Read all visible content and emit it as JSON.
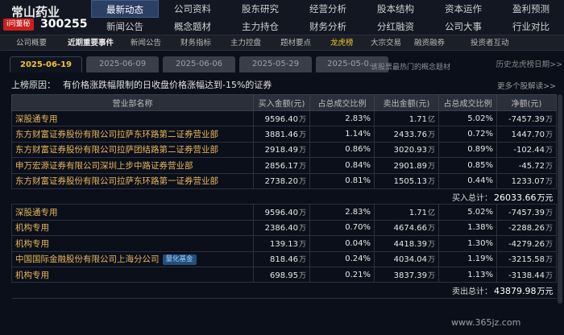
{
  "stock": {
    "name": "常山药业",
    "badge": "i问董秘",
    "code": "300255"
  },
  "nav": [
    [
      "最新动态",
      "公司资料",
      "股东研究",
      "经营分析",
      "股本结构",
      "资本运作",
      "盈利预测"
    ],
    [
      "新闻公告",
      "概念题材",
      "主力持仓",
      "财务分析",
      "分红融资",
      "公司大事",
      "行业对比"
    ]
  ],
  "nav_active": "最新动态",
  "subnav": [
    "公司概要",
    "近期重要事件",
    "新闻公告",
    "财务指标",
    "主力控盘",
    "题材要点",
    "龙虎榜",
    "大宗交易",
    "融资融券",
    "投资者互动"
  ],
  "subnav_active": "龙虎榜",
  "date_tabs": [
    "2025-06-19",
    "2025-06-09",
    "2025-06-06",
    "2025-05-29",
    "2025-05-0…"
  ],
  "tabs_more": "历史龙虎榜日期>>",
  "tabs_overlay": "该股票最热门的概念题材",
  "reason": {
    "label": "上榜原因：",
    "text": "有价格涨跌幅限制的日收盘价格涨幅达到-15%的证券",
    "more": "更多个股解读>>"
  },
  "columns": [
    "营业部名称",
    "买入金额(元)",
    "占总成交比例",
    "卖出金额(元)",
    "占总成交比例",
    "净额(元)"
  ],
  "buy_rows": [
    {
      "name": "深股通专用",
      "buy": "9596.40",
      "buy_unit": "万",
      "buy_pct": "2.83%",
      "sell": "1.71",
      "sell_unit": "亿",
      "sell_pct": "5.02%",
      "net": "-7457.39",
      "net_unit": "万"
    },
    {
      "name": "东方财富证券股份有限公司拉萨东环路第二证券营业部",
      "buy": "3881.46",
      "buy_unit": "万",
      "buy_pct": "1.14%",
      "sell": "2433.76",
      "sell_unit": "万",
      "sell_pct": "0.72%",
      "net": "1447.70",
      "net_unit": "万"
    },
    {
      "name": "东方财富证券股份有限公司拉萨团结路第二证券营业部",
      "buy": "2918.49",
      "buy_unit": "万",
      "buy_pct": "0.86%",
      "sell": "3020.93",
      "sell_unit": "万",
      "sell_pct": "0.89%",
      "net": "-102.44",
      "net_unit": "万"
    },
    {
      "name": "申万宏源证券有限公司深圳上步中路证券营业部",
      "buy": "2856.17",
      "buy_unit": "万",
      "buy_pct": "0.84%",
      "sell": "2901.89",
      "sell_unit": "万",
      "sell_pct": "0.85%",
      "net": "-45.72",
      "net_unit": "万"
    },
    {
      "name": "东方财富证券股份有限公司拉萨东环路第一证券营业部",
      "buy": "2738.20",
      "buy_unit": "万",
      "buy_pct": "0.81%",
      "sell": "1505.13",
      "sell_unit": "万",
      "sell_pct": "0.44%",
      "net": "1233.07",
      "net_unit": "万"
    }
  ],
  "buy_total": {
    "label": "买入总计：",
    "value": "26033.66",
    "unit": "万元"
  },
  "sell_rows": [
    {
      "name": "深股通专用",
      "buy": "9596.40",
      "buy_unit": "万",
      "buy_pct": "2.83%",
      "sell": "1.71",
      "sell_unit": "亿",
      "sell_pct": "5.02%",
      "net": "-7457.39",
      "net_unit": "万"
    },
    {
      "name": "机构专用",
      "buy": "2386.40",
      "buy_unit": "万",
      "buy_pct": "0.70%",
      "sell": "4674.66",
      "sell_unit": "万",
      "sell_pct": "1.38%",
      "net": "-2288.26",
      "net_unit": "万"
    },
    {
      "name": "机构专用",
      "buy": "139.13",
      "buy_unit": "万",
      "buy_pct": "0.04%",
      "sell": "4418.39",
      "sell_unit": "万",
      "sell_pct": "1.30%",
      "net": "-4279.26",
      "net_unit": "万"
    },
    {
      "name": "中国国际金融股份有限公司上海分公司",
      "tag": "量化基金",
      "buy": "818.46",
      "buy_unit": "万",
      "buy_pct": "0.24%",
      "sell": "4034.04",
      "sell_unit": "万",
      "sell_pct": "1.19%",
      "net": "-3215.58",
      "net_unit": "万"
    },
    {
      "name": "机构专用",
      "buy": "698.95",
      "buy_unit": "万",
      "buy_pct": "0.21%",
      "sell": "3837.39",
      "sell_unit": "万",
      "sell_pct": "1.13%",
      "net": "-3138.44",
      "net_unit": "万"
    }
  ],
  "sell_total": {
    "label": "卖出总计：",
    "value": "43879.98",
    "unit": "万元"
  },
  "watermark": "www.365jz.com"
}
